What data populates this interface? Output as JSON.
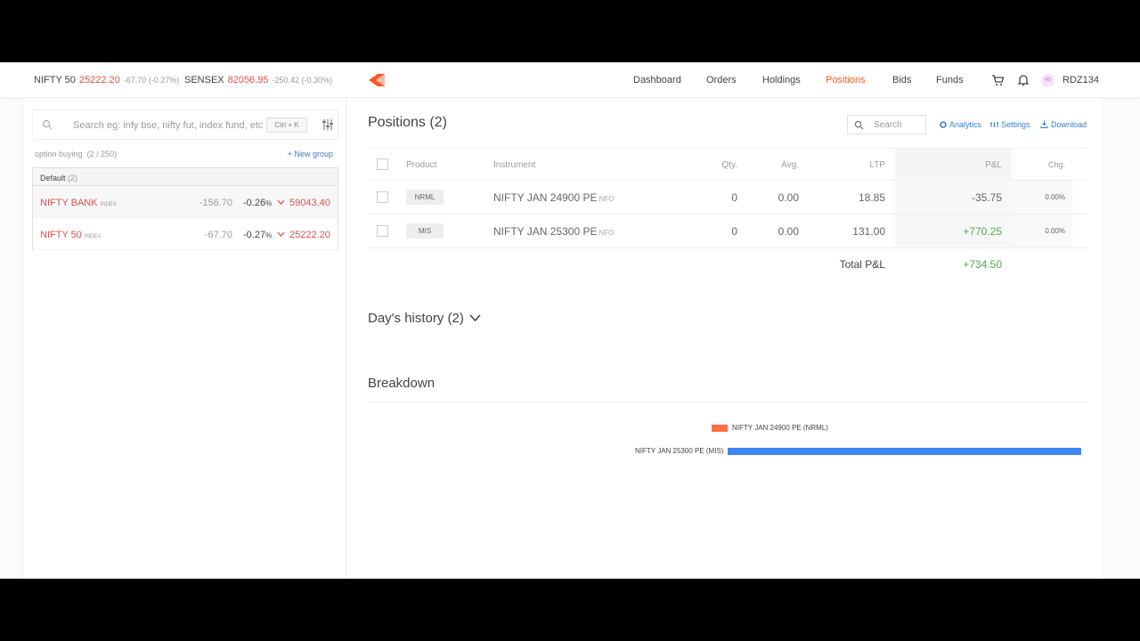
{
  "ticker": {
    "nifty": {
      "name": "NIFTY 50",
      "value": "25222.20",
      "change": "-67.70 (-0.27%)"
    },
    "sensex": {
      "name": "SENSEX",
      "value": "82056.95",
      "change": "-250.42 (-0.30%)"
    }
  },
  "nav": {
    "items": [
      "Dashboard",
      "Orders",
      "Holdings",
      "Positions",
      "Bids",
      "Funds"
    ],
    "active": "Positions",
    "avatar_initials": "MS",
    "user_id": "RDZ134",
    "cart_icon": "cart-icon",
    "bell_icon": "bell-icon"
  },
  "colors": {
    "accent": "#ff5722",
    "loss": "#df514c",
    "profit": "#4caf50",
    "link": "#387ed1",
    "bar_loss": "#ff7043",
    "bar_profit": "#4184f3"
  },
  "watchlist": {
    "search_placeholder": "Search eg: infy bse, nifty fut, index fund, etc",
    "shortcut": "Ctrl + K",
    "name": "option buying",
    "count": "(2 / 250)",
    "new_group": "New group",
    "group": {
      "name": "Default",
      "count": "(2)"
    },
    "items": [
      {
        "symbol": "NIFTY BANK",
        "tag": "INDEX",
        "change": "-156.70",
        "pct": "-0.26",
        "pct_sign": "%",
        "ltp": "59043.40"
      },
      {
        "symbol": "NIFTY 50",
        "tag": "INDEX",
        "change": "-67.70",
        "pct": "-0.27",
        "pct_sign": "%",
        "ltp": "25222.20"
      }
    ]
  },
  "positions": {
    "title": "Positions (2)",
    "search_placeholder": "Search",
    "analytics": "Analytics",
    "settings": "Settings",
    "download": "Download",
    "columns": {
      "product": "Product",
      "instrument": "Instrument",
      "qty": "Qty.",
      "avg": "Avg.",
      "ltp": "LTP",
      "pnl": "P&L",
      "chg": "Chg."
    },
    "rows": [
      {
        "product": "NRML",
        "instrument": "NIFTY JAN 24900 PE",
        "exchange": "NFO",
        "qty": "0",
        "avg": "0.00",
        "ltp": "18.85",
        "pnl": "-35.75",
        "chg": "0.00%"
      },
      {
        "product": "MIS",
        "instrument": "NIFTY JAN 25300 PE",
        "exchange": "NFO",
        "qty": "0",
        "avg": "0.00",
        "ltp": "131.00",
        "pnl": "+770.25",
        "chg": "0.00%"
      }
    ],
    "total_label": "Total P&L",
    "total_value": "+734.50"
  },
  "history": {
    "title": "Day's history (2)"
  },
  "breakdown": {
    "title": "Breakdown",
    "chart_data": {
      "type": "bar",
      "orientation": "horizontal-diverging",
      "categories": [
        "NIFTY JAN 24900 PE (NRML)",
        "NIFTY JAN 25300 PE (MIS)"
      ],
      "values": [
        -35.75,
        770.25
      ]
    }
  }
}
